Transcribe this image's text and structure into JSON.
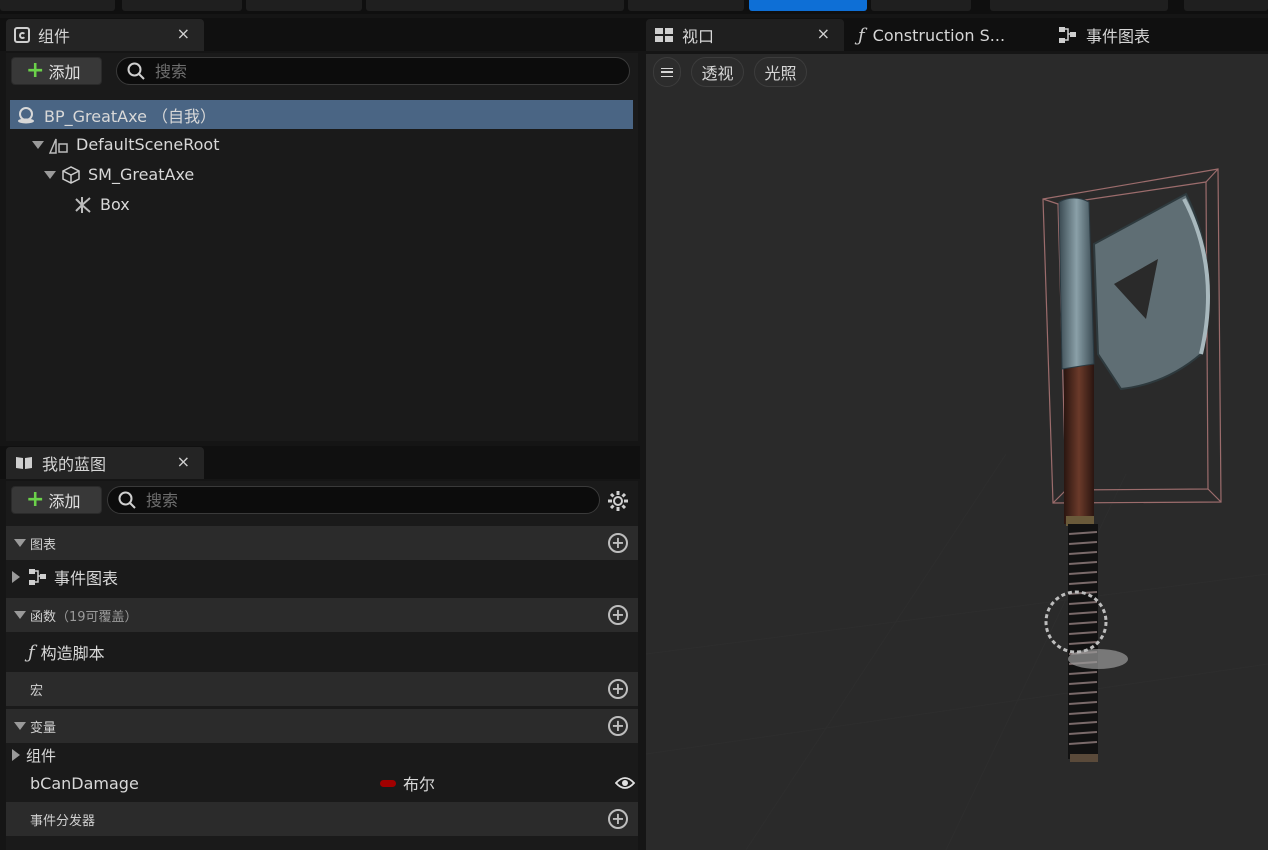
{
  "components_panel": {
    "tab_label": "组件",
    "close_label": "×",
    "add_label": "添加",
    "search_placeholder": "搜索",
    "tree": [
      {
        "label": "BP_GreatAxe （自我）"
      },
      {
        "label": "DefaultSceneRoot"
      },
      {
        "label": "SM_GreatAxe"
      },
      {
        "label": "Box"
      }
    ]
  },
  "blueprint_panel": {
    "tab_label": "我的蓝图",
    "close_label": "×",
    "add_label": "添加",
    "search_placeholder": "搜索",
    "sections": {
      "graphs": {
        "label": "图表"
      },
      "event_graph": {
        "label": "事件图表"
      },
      "functions": {
        "label": "函数",
        "note": "（19可覆盖）"
      },
      "construction_script": {
        "label": "构造脚本"
      },
      "macros": {
        "label": "宏"
      },
      "variables": {
        "label": "变量"
      },
      "components": {
        "label": "组件"
      },
      "variable_row": {
        "name": "bCanDamage",
        "type": "布尔",
        "type_color": "#a10000"
      },
      "event_dispatchers": {
        "label": "事件分发器"
      }
    }
  },
  "editor_tabs": {
    "viewport": "视口",
    "construction": "Construction S...",
    "event_graph": "事件图表",
    "close_label": "×"
  },
  "viewport_toolbar": {
    "menu_icon": "hamburger-icon",
    "perspective": "透视",
    "lighting": "光照"
  },
  "colors": {
    "accent_blue": "#0e6fd6",
    "selection": "#4a6584",
    "add_plus": "#6bd14a"
  }
}
